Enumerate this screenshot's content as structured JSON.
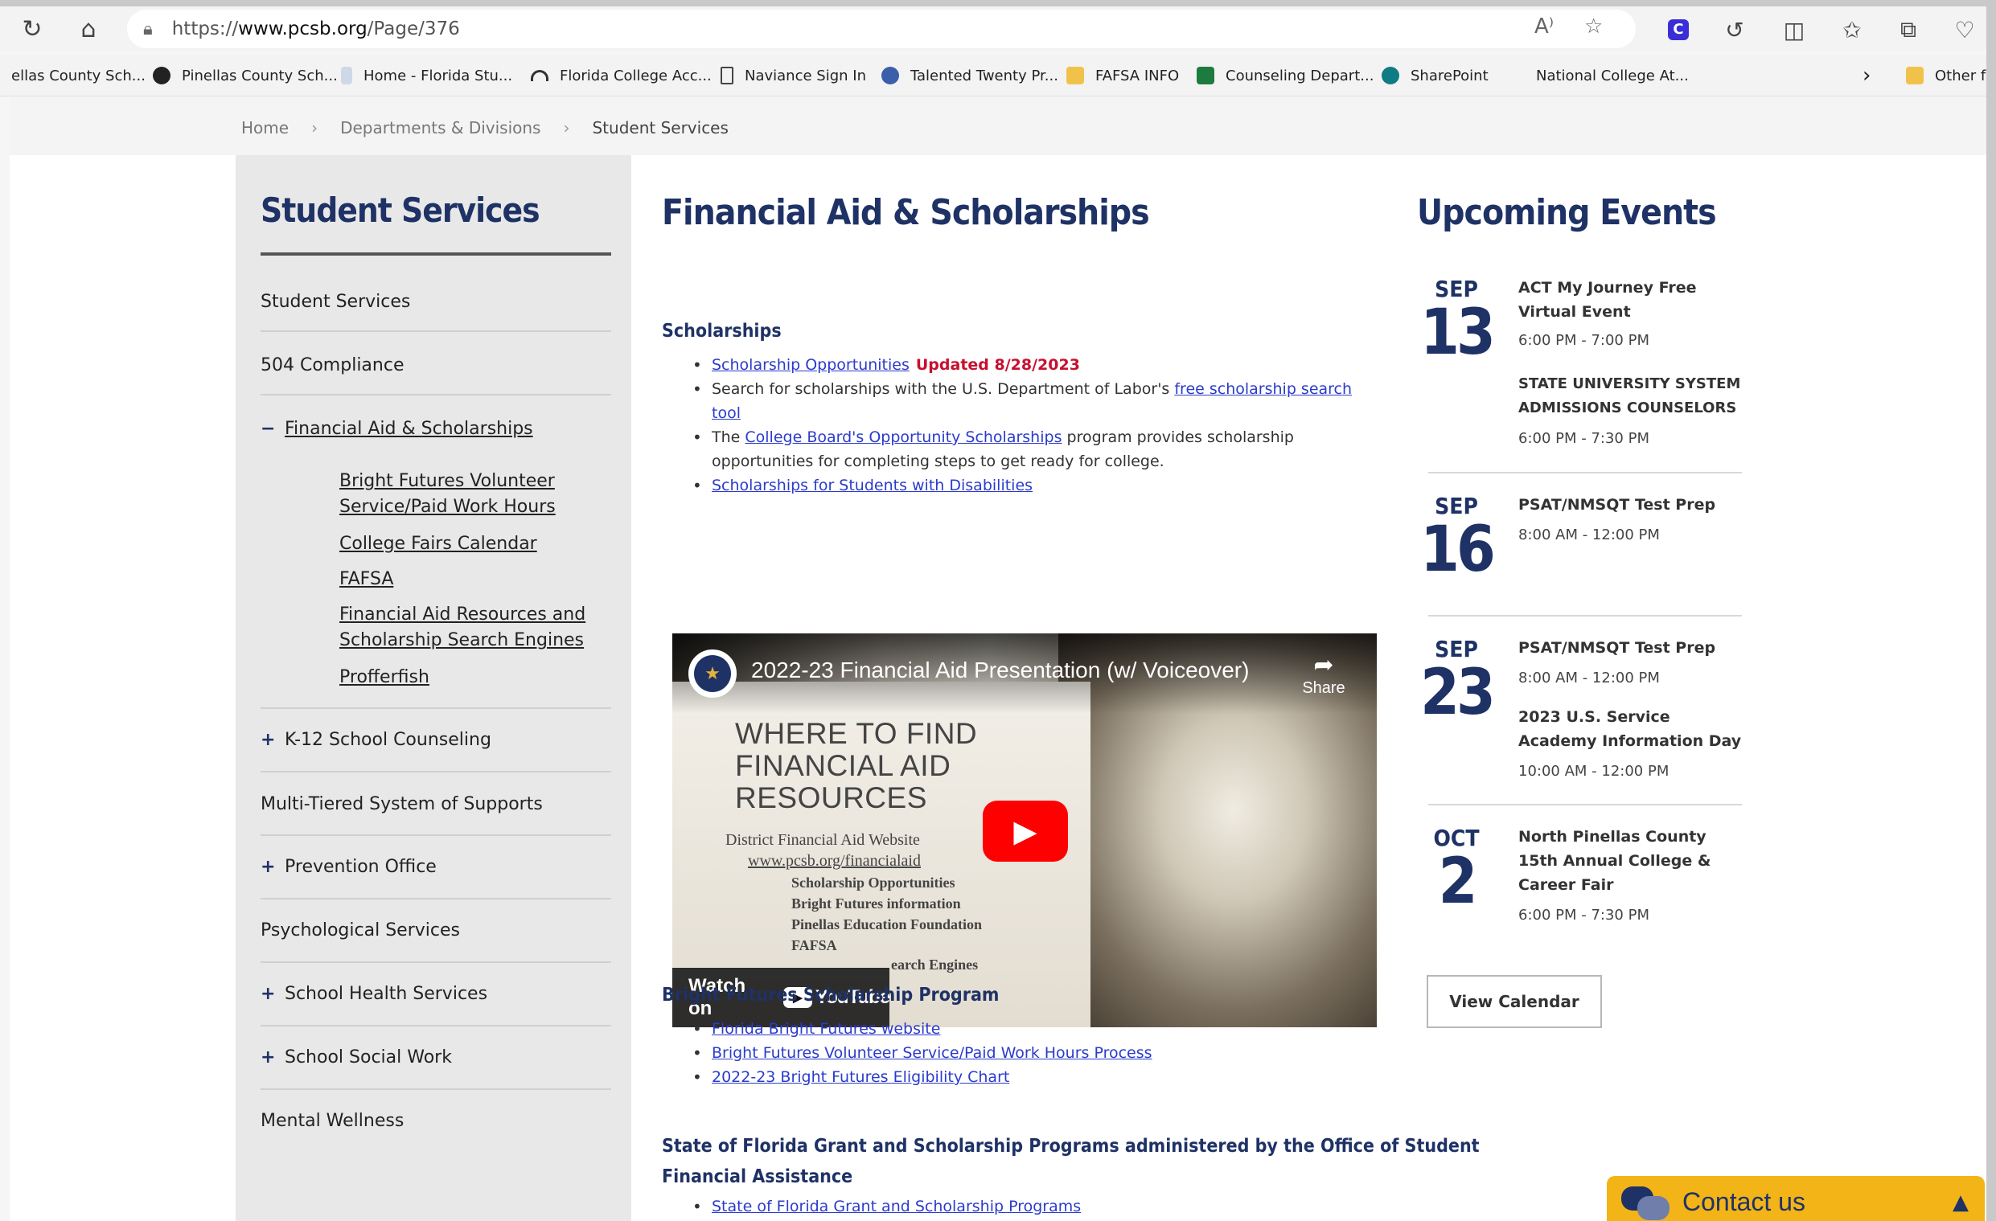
{
  "browser": {
    "url_prefix": "https://",
    "url_domain": "www.pcsb.org",
    "url_path": "/Page/376",
    "favorites": [
      "ellas County Sch...",
      "Pinellas County Sch...",
      "Home - Florida Stu...",
      "Florida College Acc...",
      "Naviance Sign In",
      "Talented Twenty Pr...",
      "FAFSA INFO",
      "Counseling Depart...",
      "SharePoint",
      "National College At...",
      "Other fa"
    ]
  },
  "breadcrumb": {
    "home": "Home",
    "section": "Departments & Divisions",
    "current": "Student Services"
  },
  "sidebar": {
    "title": "Student Services",
    "items": [
      {
        "label": "Student Services",
        "symbol": ""
      },
      {
        "label": "504 Compliance",
        "symbol": ""
      },
      {
        "label": "Financial Aid & Scholarships",
        "symbol": "−"
      },
      {
        "label": "K-12 School Counseling",
        "symbol": "+"
      },
      {
        "label": "Multi-Tiered System of Supports",
        "symbol": ""
      },
      {
        "label": "Prevention Office",
        "symbol": "+"
      },
      {
        "label": "Psychological Services",
        "symbol": ""
      },
      {
        "label": "School Health Services",
        "symbol": "+"
      },
      {
        "label": "School Social Work",
        "symbol": "+"
      },
      {
        "label": "Mental Wellness",
        "symbol": ""
      }
    ],
    "subitems": [
      "Bright Futures Volunteer Service/Paid Work Hours",
      "College Fairs Calendar",
      "FAFSA",
      "Financial Aid Resources and Scholarship Search Engines",
      "Profferfish"
    ]
  },
  "main": {
    "title": "Financial Aid & Scholarships",
    "scholarships": {
      "heading": "Scholarships",
      "b1_link": "Scholarship Opportunities",
      "b1_updated": "Updated 8/28/2023",
      "b2_text": "Search for scholarships with the U.S. Department of Labor's ",
      "b2_link_a": "free scholarship search",
      "b2_link_b": "tool",
      "b3_pre": "The ",
      "b3_link": "College Board's Opportunity Scholarships",
      "b3_post": " program provides scholarship",
      "b3_line2": "opportunities for completing steps to get ready for college.",
      "b4_link": "Scholarships for Students with Disabilities"
    },
    "video": {
      "title": "2022-23 Financial Aid Presentation (w/ Voiceover)",
      "share": "Share",
      "slide_h1": "WHERE TO FIND",
      "slide_h2": "FINANCIAL AID",
      "slide_h3": "RESOURCES",
      "slide_l1": "District Financial Aid Website",
      "slide_l2": "www.pcsb.org/financialaid",
      "slide_l3": "Scholarship Opportunities",
      "slide_l4": "Bright Futures information",
      "slide_l5": "Pinellas Education Foundation",
      "slide_l6": "FAFSA",
      "slide_l7": "earch Engines",
      "watch_on": "Watch on",
      "youtube": "YouTube"
    },
    "bright_futures": {
      "heading": "Bright Futures Scholarship Program",
      "links": [
        "Florida Bright Futures website",
        "Bright Futures Volunteer Service/Paid Work Hours Process",
        "2022-23 Bright Futures Eligibility Chart"
      ]
    },
    "state": {
      "heading_1": "State of Florida Grant and Scholarship Programs administered by the Office of Student",
      "heading_2": "Financial Assistance",
      "link": "State of Florida Grant and Scholarship Programs"
    }
  },
  "events": {
    "title": "Upcoming Events",
    "items": [
      {
        "month": "SEP",
        "day": "13",
        "title1": "ACT My Journey Free Virtual Event",
        "time1": "6:00 PM - 7:00 PM",
        "title2": "STATE UNIVERSITY SYSTEM ADMISSIONS COUNSELORS",
        "time2": "6:00 PM - 7:30 PM"
      },
      {
        "month": "SEP",
        "day": "16",
        "title1": "PSAT/NMSQT Test Prep",
        "time1": "8:00 AM - 12:00 PM"
      },
      {
        "month": "SEP",
        "day": "23",
        "title1": "PSAT/NMSQT Test Prep",
        "time1": "8:00 AM - 12:00 PM",
        "title2": "2023 U.S. Service Academy Information Day",
        "time2": "10:00 AM - 12:00 PM"
      },
      {
        "month": "OCT",
        "day": "2",
        "title1": "North Pinellas County 15th Annual College & Career Fair",
        "time1": "6:00 PM - 7:30 PM"
      }
    ],
    "view_calendar": "View Calendar"
  },
  "contact": {
    "label": "Contact us"
  },
  "colors": {
    "navy": "#1f3266",
    "link": "#2b3bcc",
    "updated": "#c8102e",
    "contact_bg": "#f2b417"
  }
}
